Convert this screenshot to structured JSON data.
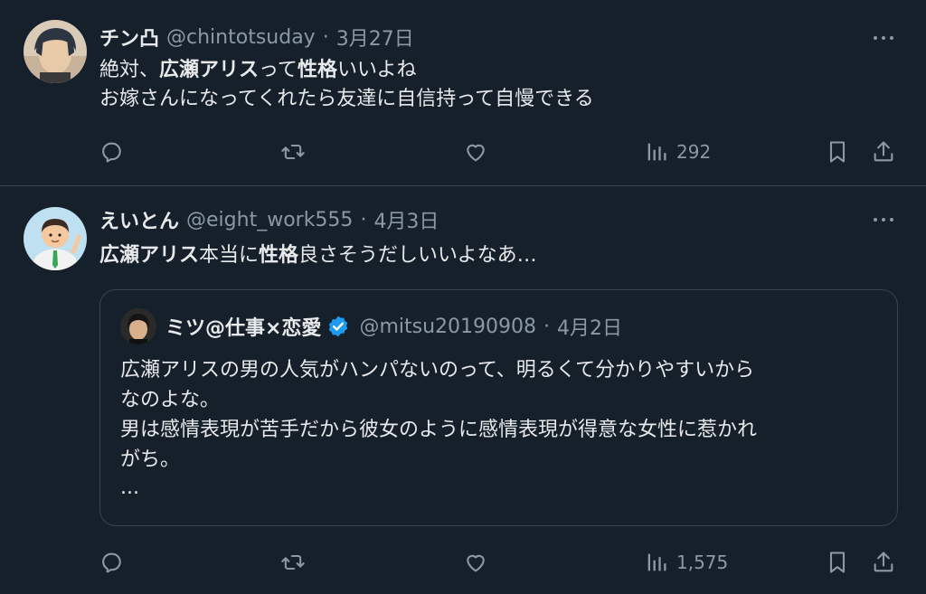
{
  "tweets": [
    {
      "name": "チン凸",
      "handle": "@chintotsuday",
      "separator": "·",
      "date": "3月27日",
      "line1": {
        "a": "絶対、",
        "b": "広瀬アリス",
        "c": "って",
        "d": "性格",
        "e": "いいよね"
      },
      "line2": "お嫁さんになってくれたら友達に自信持って自慢できる",
      "views": "292"
    },
    {
      "name": "えいとん",
      "handle": "@eight_work555",
      "separator": "·",
      "date": "4月3日",
      "line1": {
        "a": "広瀬アリス",
        "b": "本当に",
        "c": "性格",
        "d": "良さそうだしいいよなあ…"
      },
      "views": "1,575",
      "quote": {
        "name": "ミツ@仕事×恋愛",
        "handle": "@mitsu20190908",
        "separator": "·",
        "date": "4月2日",
        "lines": [
          "広瀬アリスの男の人気がハンパないのって、明るくて分かりやすいから",
          "なのよな。",
          "男は感情表現が苦手だから彼女のように感情表現が得意な女性に惹かれ",
          "がち。"
        ],
        "ellipsis": "..."
      }
    }
  ],
  "icons": {
    "reply": "reply-icon",
    "retweet": "retweet-icon",
    "like": "like-icon",
    "views": "views-icon",
    "bookmark": "bookmark-icon",
    "share": "share-icon",
    "more": "more-icon",
    "verified": "verified-badge-icon"
  },
  "colors": {
    "background": "#15202b",
    "text": "#e7e9ea",
    "secondary": "#8b98a5",
    "border": "#38444d",
    "verified": "#1d9bf0"
  }
}
